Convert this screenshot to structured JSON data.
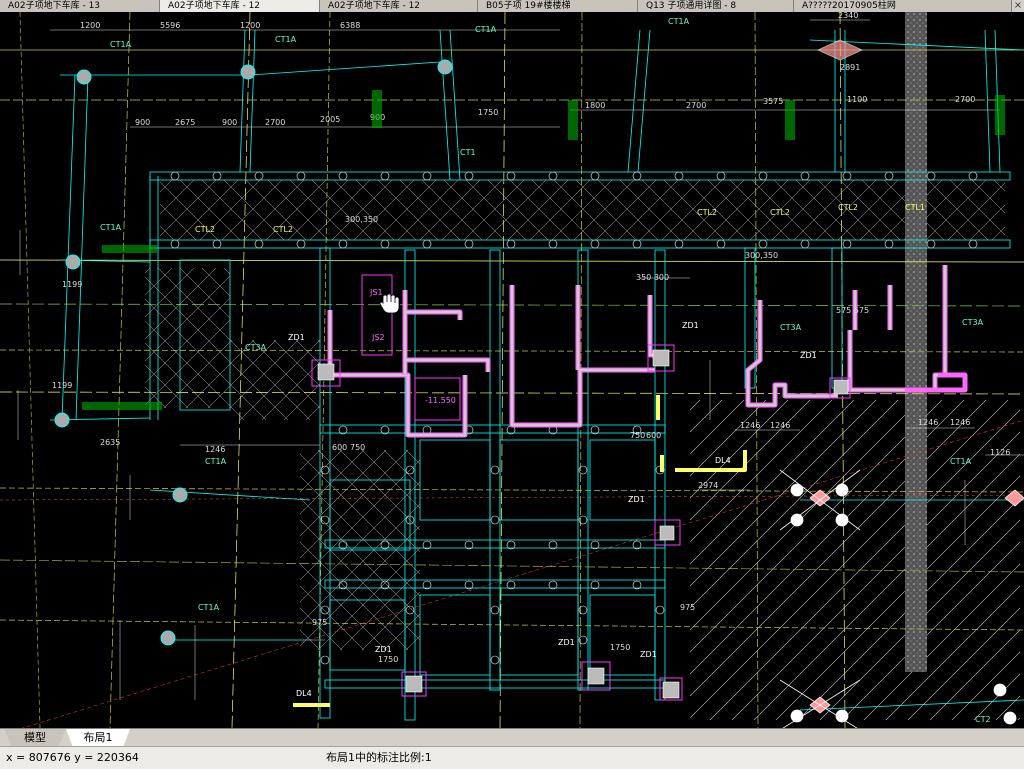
{
  "document_tabs": [
    {
      "label": "A02子项地下车库 - 13",
      "active": false
    },
    {
      "label": "A02子项地下车库 - 12",
      "active": true
    },
    {
      "label": "A02子项地下车库 - 12",
      "active": false
    },
    {
      "label": "B05子项 19#楼楼梯",
      "active": false
    },
    {
      "label": "Q13 子项通用详图 - 8",
      "active": false
    },
    {
      "label": "A?????20170905柱网",
      "active": false
    }
  ],
  "layout_tabs": [
    {
      "label": "模型",
      "active": false
    },
    {
      "label": "布局1",
      "active": true
    }
  ],
  "status": {
    "coordinates": "x = 807676  y = 220364",
    "scale_text": "布局1中的标注比例:1"
  },
  "drawing": {
    "colors": {
      "background": "#000000",
      "column": "#ffffff",
      "beam": "#00ffff",
      "axis": "#ffff66",
      "magenta": "#ff33ff",
      "green_text": "#00ff00",
      "hatch": "#ffffff"
    },
    "labels": {
      "ct1a": "CT1A",
      "ct1": "CT1",
      "ct3a": "CT3A",
      "ct2": "CT2",
      "zd1": "ZD1",
      "dl4": "DL4",
      "ctl2": "CTL2",
      "ctl1": "CTL1",
      "js1": "JS1",
      "js2": "JS2",
      "elev": "-11.550",
      "dim_1200": "1200",
      "dim_5596": "5596",
      "dim_6388": "6388",
      "dim_2340": "2340",
      "dim_2891": "2891",
      "dim_1750": "1750",
      "dim_1800": "1800",
      "dim_2700": "2700",
      "dim_3575": "3575",
      "dim_1100": "1100",
      "dim_2675": "2675",
      "dim_900": "900",
      "dim_2005": "2005",
      "dim_1246": "1246",
      "dim_2974": "2974",
      "dim_750": "750",
      "dim_600": "600",
      "dim_975": "975",
      "dim_1199": "1199",
      "dim_2635": "2635",
      "dim_1126": "1126",
      "dim_300_350": "300,350",
      "dim_575": "575 575",
      "dim_350_300": "350 300"
    }
  }
}
